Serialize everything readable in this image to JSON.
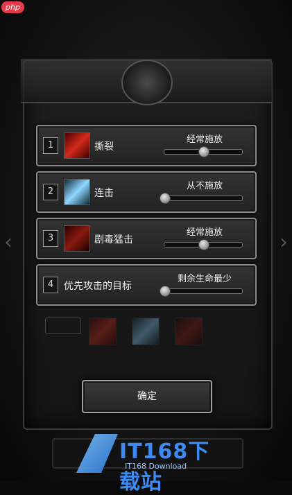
{
  "skills": [
    {
      "num": "1",
      "name": "撕裂",
      "mode": "经常施放",
      "icon": "slash-red-icon",
      "level": 0.5
    },
    {
      "num": "2",
      "name": "连击",
      "mode": "从不施放",
      "icon": "slash-blue-icon",
      "level": 0.0
    },
    {
      "num": "3",
      "name": "剧毒猛击",
      "mode": "经常施放",
      "icon": "slash-dark-red-icon",
      "level": 0.5
    }
  ],
  "target": {
    "num": "4",
    "name": "优先攻击的目标",
    "mode": "剩余生命最少",
    "level": 0.0
  },
  "confirm_label": "确定",
  "watermark": {
    "main": "IT168下载站",
    "sub": "IT168 Download"
  },
  "badge": "php",
  "colors": {
    "accent_red": "#d42a1a",
    "accent_blue": "#8fd7ff",
    "watermark_blue": "#3d8bf2"
  }
}
